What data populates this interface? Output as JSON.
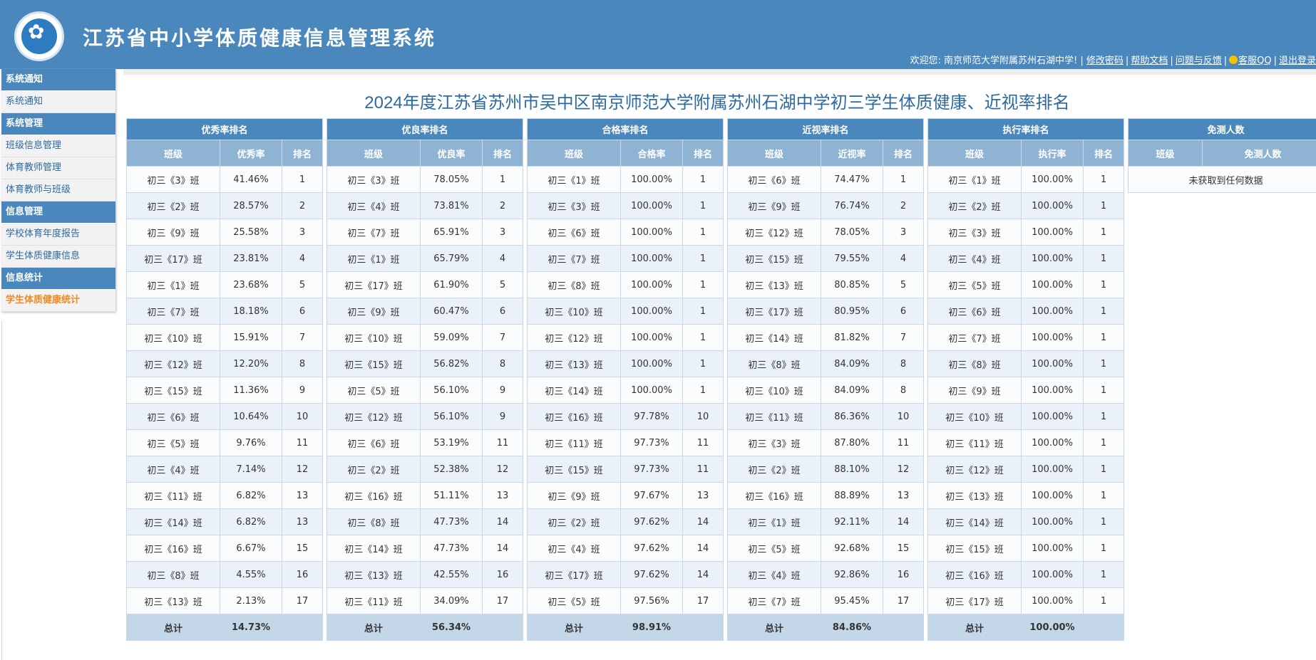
{
  "header": {
    "title": "江苏省中小学体质健康信息管理系统",
    "welcome": "欢迎您: 南京师范大学附属苏州石湖中学! |",
    "links": [
      "修改密码",
      "帮助文档",
      "问题与反馈",
      "客服QQ",
      "退出登录"
    ]
  },
  "sidebar": [
    {
      "group": "系统通知",
      "items": [
        {
          "label": "系统通知"
        }
      ]
    },
    {
      "group": "系统管理",
      "items": [
        {
          "label": "班级信息管理"
        },
        {
          "label": "体育教师管理"
        },
        {
          "label": "体育教师与班级"
        }
      ]
    },
    {
      "group": "信息管理",
      "items": [
        {
          "label": "学校体育年度报告"
        },
        {
          "label": "学生体质健康信息"
        }
      ]
    },
    {
      "group": "信息统计",
      "items": [
        {
          "label": "学生体质健康统计",
          "active": true
        }
      ]
    }
  ],
  "page_title": "2024年度江苏省苏州市吴中区南京师范大学附属苏州石湖中学初三学生体质健康、近视率排名",
  "tables": [
    {
      "title": "优秀率排名",
      "headers": [
        "班级",
        "优秀率",
        "排名"
      ],
      "rows": [
        [
          "初三《3》班",
          "41.46%",
          "1"
        ],
        [
          "初三《2》班",
          "28.57%",
          "2"
        ],
        [
          "初三《9》班",
          "25.58%",
          "3"
        ],
        [
          "初三《17》班",
          "23.81%",
          "4"
        ],
        [
          "初三《1》班",
          "23.68%",
          "5"
        ],
        [
          "初三《7》班",
          "18.18%",
          "6"
        ],
        [
          "初三《10》班",
          "15.91%",
          "7"
        ],
        [
          "初三《12》班",
          "12.20%",
          "8"
        ],
        [
          "初三《15》班",
          "11.36%",
          "9"
        ],
        [
          "初三《6》班",
          "10.64%",
          "10"
        ],
        [
          "初三《5》班",
          "9.76%",
          "11"
        ],
        [
          "初三《4》班",
          "7.14%",
          "12"
        ],
        [
          "初三《11》班",
          "6.82%",
          "13"
        ],
        [
          "初三《14》班",
          "6.82%",
          "13"
        ],
        [
          "初三《16》班",
          "6.67%",
          "15"
        ],
        [
          "初三《8》班",
          "4.55%",
          "16"
        ],
        [
          "初三《13》班",
          "2.13%",
          "17"
        ]
      ],
      "total": [
        "总计",
        "14.73%",
        ""
      ]
    },
    {
      "title": "优良率排名",
      "headers": [
        "班级",
        "优良率",
        "排名"
      ],
      "rows": [
        [
          "初三《3》班",
          "78.05%",
          "1"
        ],
        [
          "初三《4》班",
          "73.81%",
          "2"
        ],
        [
          "初三《7》班",
          "65.91%",
          "3"
        ],
        [
          "初三《1》班",
          "65.79%",
          "4"
        ],
        [
          "初三《17》班",
          "61.90%",
          "5"
        ],
        [
          "初三《9》班",
          "60.47%",
          "6"
        ],
        [
          "初三《10》班",
          "59.09%",
          "7"
        ],
        [
          "初三《15》班",
          "56.82%",
          "8"
        ],
        [
          "初三《5》班",
          "56.10%",
          "9"
        ],
        [
          "初三《12》班",
          "56.10%",
          "9"
        ],
        [
          "初三《6》班",
          "53.19%",
          "11"
        ],
        [
          "初三《2》班",
          "52.38%",
          "12"
        ],
        [
          "初三《16》班",
          "51.11%",
          "13"
        ],
        [
          "初三《8》班",
          "47.73%",
          "14"
        ],
        [
          "初三《14》班",
          "47.73%",
          "14"
        ],
        [
          "初三《13》班",
          "42.55%",
          "16"
        ],
        [
          "初三《11》班",
          "34.09%",
          "17"
        ]
      ],
      "total": [
        "总计",
        "56.34%",
        ""
      ]
    },
    {
      "title": "合格率排名",
      "headers": [
        "班级",
        "合格率",
        "排名"
      ],
      "rows": [
        [
          "初三《1》班",
          "100.00%",
          "1"
        ],
        [
          "初三《3》班",
          "100.00%",
          "1"
        ],
        [
          "初三《6》班",
          "100.00%",
          "1"
        ],
        [
          "初三《7》班",
          "100.00%",
          "1"
        ],
        [
          "初三《8》班",
          "100.00%",
          "1"
        ],
        [
          "初三《10》班",
          "100.00%",
          "1"
        ],
        [
          "初三《12》班",
          "100.00%",
          "1"
        ],
        [
          "初三《13》班",
          "100.00%",
          "1"
        ],
        [
          "初三《14》班",
          "100.00%",
          "1"
        ],
        [
          "初三《16》班",
          "97.78%",
          "10"
        ],
        [
          "初三《11》班",
          "97.73%",
          "11"
        ],
        [
          "初三《15》班",
          "97.73%",
          "11"
        ],
        [
          "初三《9》班",
          "97.67%",
          "13"
        ],
        [
          "初三《2》班",
          "97.62%",
          "14"
        ],
        [
          "初三《4》班",
          "97.62%",
          "14"
        ],
        [
          "初三《17》班",
          "97.62%",
          "14"
        ],
        [
          "初三《5》班",
          "97.56%",
          "17"
        ]
      ],
      "total": [
        "总计",
        "98.91%",
        ""
      ]
    },
    {
      "title": "近视率排名",
      "headers": [
        "班级",
        "近视率",
        "排名"
      ],
      "rows": [
        [
          "初三《6》班",
          "74.47%",
          "1"
        ],
        [
          "初三《9》班",
          "76.74%",
          "2"
        ],
        [
          "初三《12》班",
          "78.05%",
          "3"
        ],
        [
          "初三《15》班",
          "79.55%",
          "4"
        ],
        [
          "初三《13》班",
          "80.85%",
          "5"
        ],
        [
          "初三《17》班",
          "80.95%",
          "6"
        ],
        [
          "初三《14》班",
          "81.82%",
          "7"
        ],
        [
          "初三《8》班",
          "84.09%",
          "8"
        ],
        [
          "初三《10》班",
          "84.09%",
          "8"
        ],
        [
          "初三《11》班",
          "86.36%",
          "10"
        ],
        [
          "初三《3》班",
          "87.80%",
          "11"
        ],
        [
          "初三《2》班",
          "88.10%",
          "12"
        ],
        [
          "初三《16》班",
          "88.89%",
          "13"
        ],
        [
          "初三《1》班",
          "92.11%",
          "14"
        ],
        [
          "初三《5》班",
          "92.68%",
          "15"
        ],
        [
          "初三《4》班",
          "92.86%",
          "16"
        ],
        [
          "初三《7》班",
          "95.45%",
          "17"
        ]
      ],
      "total": [
        "总计",
        "84.86%",
        ""
      ]
    },
    {
      "title": "执行率排名",
      "headers": [
        "班级",
        "执行率",
        "排名"
      ],
      "rows": [
        [
          "初三《1》班",
          "100.00%",
          "1"
        ],
        [
          "初三《2》班",
          "100.00%",
          "1"
        ],
        [
          "初三《3》班",
          "100.00%",
          "1"
        ],
        [
          "初三《4》班",
          "100.00%",
          "1"
        ],
        [
          "初三《5》班",
          "100.00%",
          "1"
        ],
        [
          "初三《6》班",
          "100.00%",
          "1"
        ],
        [
          "初三《7》班",
          "100.00%",
          "1"
        ],
        [
          "初三《8》班",
          "100.00%",
          "1"
        ],
        [
          "初三《9》班",
          "100.00%",
          "1"
        ],
        [
          "初三《10》班",
          "100.00%",
          "1"
        ],
        [
          "初三《11》班",
          "100.00%",
          "1"
        ],
        [
          "初三《12》班",
          "100.00%",
          "1"
        ],
        [
          "初三《13》班",
          "100.00%",
          "1"
        ],
        [
          "初三《14》班",
          "100.00%",
          "1"
        ],
        [
          "初三《15》班",
          "100.00%",
          "1"
        ],
        [
          "初三《16》班",
          "100.00%",
          "1"
        ],
        [
          "初三《17》班",
          "100.00%",
          "1"
        ]
      ],
      "total": [
        "总计",
        "100.00%",
        ""
      ]
    },
    {
      "title": "免测人数",
      "headers": [
        "班级",
        "免测人数"
      ],
      "empty_message": "未获取到任何数据"
    }
  ]
}
